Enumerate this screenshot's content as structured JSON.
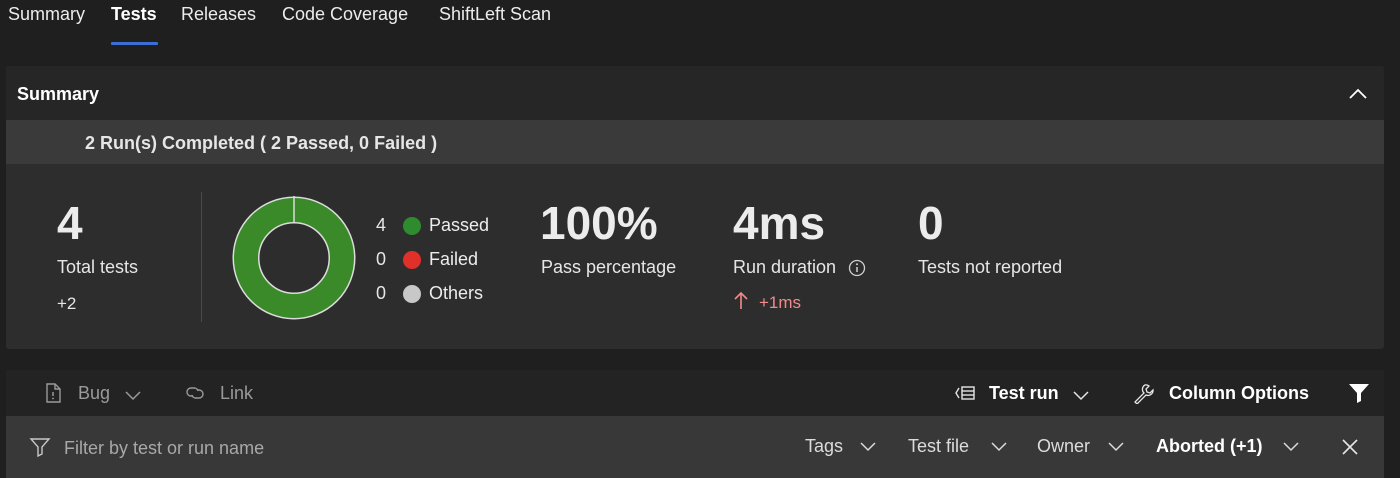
{
  "tabs": [
    {
      "label": "Summary",
      "active": false
    },
    {
      "label": "Tests",
      "active": true
    },
    {
      "label": "Releases",
      "active": false
    },
    {
      "label": "Code Coverage",
      "active": false
    },
    {
      "label": "ShiftLeft Scan",
      "active": false
    }
  ],
  "summary": {
    "title": "Summary",
    "run_status": "2 Run(s) Completed ( 2 Passed, 0 Failed )",
    "total_tests": {
      "value": "4",
      "label": "Total tests",
      "delta": "+2"
    },
    "outcomes": [
      {
        "count": "4",
        "label": "Passed",
        "color": "#2e8b2e"
      },
      {
        "count": "0",
        "label": "Failed",
        "color": "#e0302a"
      },
      {
        "count": "0",
        "label": "Others",
        "color": "#c8c8c8"
      }
    ],
    "donut_color": "#3a8a2a",
    "pass_percentage": {
      "value": "100%",
      "label": "Pass percentage"
    },
    "run_duration": {
      "value": "4ms",
      "label": "Run duration",
      "delta": "+1ms",
      "delta_icon": "arrow-up-icon",
      "delta_color": "#f28a8a"
    },
    "not_reported": {
      "value": "0",
      "label": "Tests not reported"
    }
  },
  "toolbar": {
    "bug_label": "Bug",
    "link_label": "Link",
    "test_run_label": "Test run",
    "column_options_label": "Column Options"
  },
  "filter": {
    "placeholder": "Filter by test or run name",
    "value": "",
    "dropdowns": [
      {
        "label": "Tags"
      },
      {
        "label": "Test file"
      },
      {
        "label": "Owner"
      },
      {
        "label": "Aborted (+1)"
      }
    ]
  },
  "colors": {
    "accent": "#3b6fd6",
    "background": "#1f1f1f",
    "card": "#2d2d2d"
  }
}
